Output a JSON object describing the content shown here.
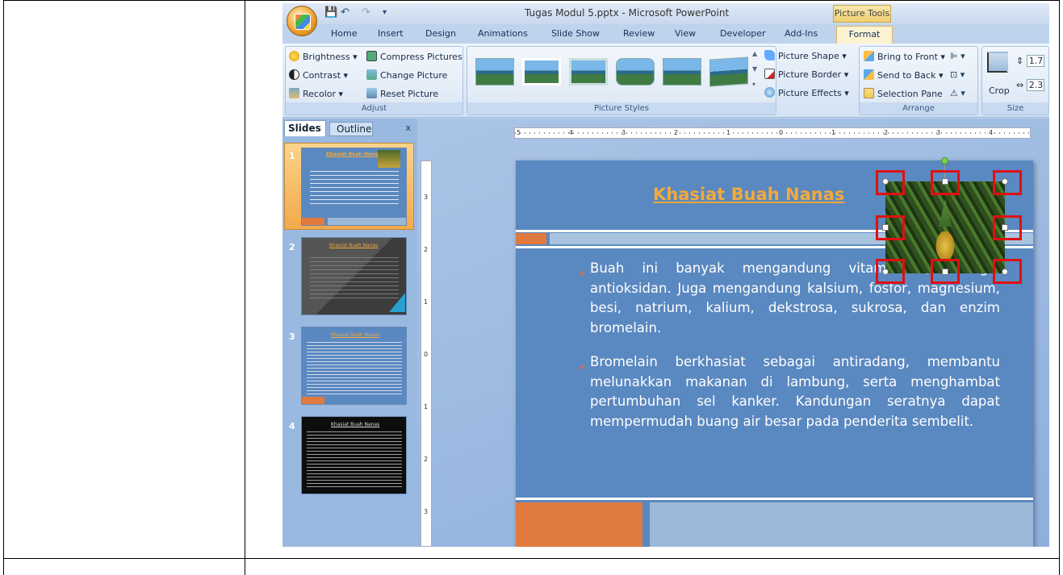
{
  "window": {
    "title": "Tugas Modul 5.pptx - Microsoft PowerPoint",
    "contextual_tab_group": "Picture Tools"
  },
  "tabs": [
    "Home",
    "Insert",
    "Design",
    "Animations",
    "Slide Show",
    "Review",
    "View",
    "Developer",
    "Add-Ins",
    "Format"
  ],
  "active_tab": "Format",
  "ribbon": {
    "adjust": {
      "label": "Adjust",
      "brightness": "Brightness",
      "contrast": "Contrast",
      "recolor": "Recolor",
      "compress": "Compress Pictures",
      "change": "Change Picture",
      "reset": "Reset Picture"
    },
    "styles": {
      "label": "Picture Styles",
      "shape": "Picture Shape",
      "border": "Picture Border",
      "effects": "Picture Effects"
    },
    "arrange": {
      "label": "Arrange",
      "front": "Bring to Front",
      "back": "Send to Back",
      "pane": "Selection Pane"
    },
    "size": {
      "label": "Size",
      "crop": "Crop",
      "height": "1.7",
      "width": "2.3"
    }
  },
  "pane": {
    "slides_tab": "Slides",
    "outline_tab": "Outline",
    "close": "x",
    "numbers": [
      "1",
      "2",
      "3",
      "4"
    ]
  },
  "ruler": {
    "h": [
      "5",
      "4",
      "3",
      "2",
      "1",
      "0",
      "1",
      "2",
      "3",
      "4"
    ],
    "v": [
      "3",
      "2",
      "1",
      "0",
      "1",
      "2",
      "3"
    ]
  },
  "slide": {
    "title": "Khasiat Buah Nanas",
    "bullet1": "Buah ini banyak mengandung vitamin C, sebagai antioksidan. Juga mengandung kalsium, fosfor, magnesium, besi, natrium, kalium, dekstrosa, sukrosa, dan enzim bromelain.",
    "bullet2": "Bromelain berkhasiat sebagai antiradang, membantu melunakkan makanan di lambung, serta menghambat pertumbuhan sel kanker. Kandungan seratnya dapat mempermudah buang air besar pada penderita sembelit."
  },
  "thumbs": {
    "t1": "Khasiat Buah Nanas",
    "t2": "Khasiat Buah Nanas",
    "t3": "Khasiat Buah Nanas",
    "t4": "Khasiat Buah Nanas"
  },
  "colors": {
    "slide_bg": "#5a88c0",
    "title": "#f2a93a",
    "accent_orange": "#e07a3e",
    "selection": "#e01010"
  }
}
